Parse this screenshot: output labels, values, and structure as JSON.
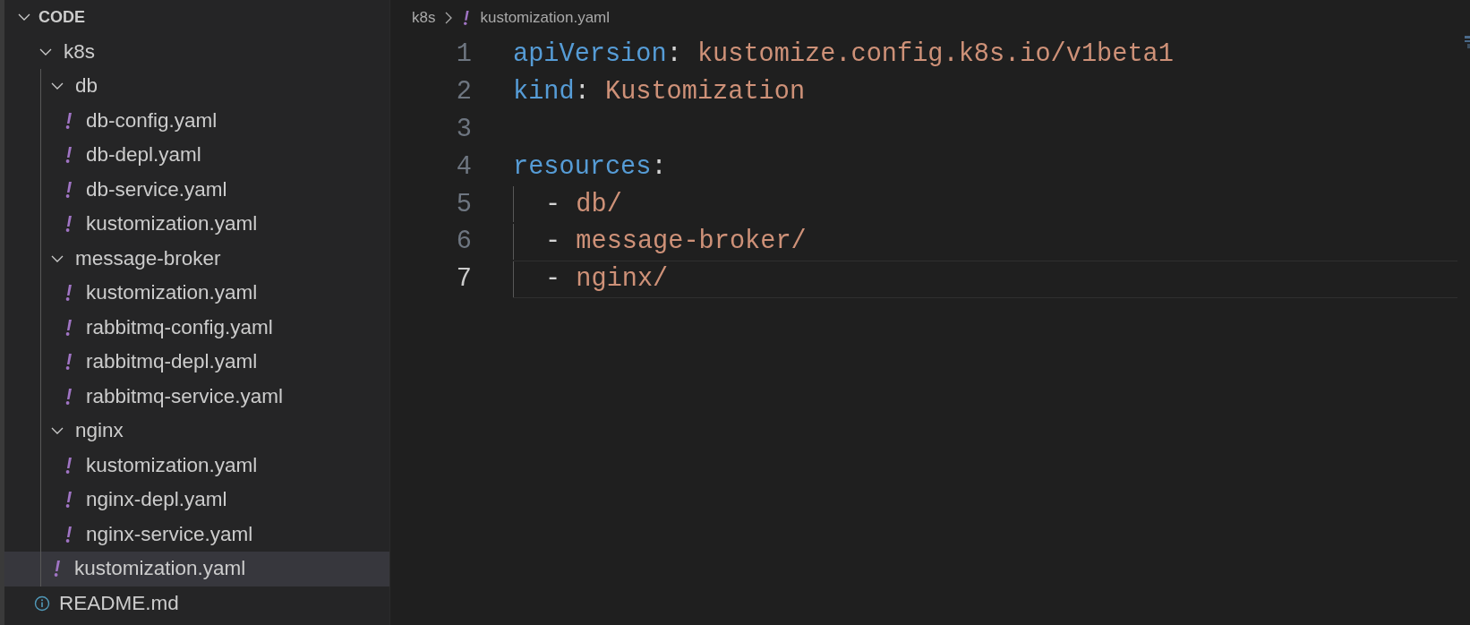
{
  "explorer": {
    "title": "CODE",
    "expanded": true,
    "items": [
      {
        "kind": "folder",
        "name": "k8s",
        "expanded": true,
        "selected": false,
        "children": [
          {
            "kind": "folder",
            "name": "db",
            "expanded": true,
            "selected": false,
            "children": [
              {
                "kind": "yaml",
                "name": "db-config.yaml",
                "selected": false
              },
              {
                "kind": "yaml",
                "name": "db-depl.yaml",
                "selected": false
              },
              {
                "kind": "yaml",
                "name": "db-service.yaml",
                "selected": false
              },
              {
                "kind": "yaml",
                "name": "kustomization.yaml",
                "selected": false
              }
            ]
          },
          {
            "kind": "folder",
            "name": "message-broker",
            "expanded": true,
            "selected": false,
            "children": [
              {
                "kind": "yaml",
                "name": "kustomization.yaml",
                "selected": false
              },
              {
                "kind": "yaml",
                "name": "rabbitmq-config.yaml",
                "selected": false
              },
              {
                "kind": "yaml",
                "name": "rabbitmq-depl.yaml",
                "selected": false
              },
              {
                "kind": "yaml",
                "name": "rabbitmq-service.yaml",
                "selected": false
              }
            ]
          },
          {
            "kind": "folder",
            "name": "nginx",
            "expanded": true,
            "selected": false,
            "children": [
              {
                "kind": "yaml",
                "name": "kustomization.yaml",
                "selected": false
              },
              {
                "kind": "yaml",
                "name": "nginx-depl.yaml",
                "selected": false
              },
              {
                "kind": "yaml",
                "name": "nginx-service.yaml",
                "selected": false
              }
            ]
          },
          {
            "kind": "yaml",
            "name": "kustomization.yaml",
            "selected": true
          }
        ]
      },
      {
        "kind": "info",
        "name": "README.md",
        "selected": false
      }
    ]
  },
  "editor": {
    "breadcrumb": [
      {
        "kind": "folder",
        "text": "k8s"
      },
      {
        "kind": "yaml",
        "text": "kustomization.yaml"
      }
    ],
    "lines": [
      {
        "number": "1",
        "active": false,
        "indented": false,
        "tokens": [
          {
            "kind": "key",
            "text": "apiVersion"
          },
          {
            "kind": "punct",
            "text": ": "
          },
          {
            "kind": "string",
            "text": "kustomize.config.k8s.io/v1beta1"
          }
        ]
      },
      {
        "number": "2",
        "active": false,
        "indented": false,
        "tokens": [
          {
            "kind": "key",
            "text": "kind"
          },
          {
            "kind": "punct",
            "text": ": "
          },
          {
            "kind": "string",
            "text": "Kustomization"
          }
        ]
      },
      {
        "number": "3",
        "active": false,
        "indented": false
      },
      {
        "number": "4",
        "active": false,
        "indented": false,
        "tokens": [
          {
            "kind": "key",
            "text": "resources"
          },
          {
            "kind": "punct",
            "text": ":"
          }
        ]
      },
      {
        "number": "5",
        "active": false,
        "indented": true,
        "tokens": [
          {
            "kind": "punct",
            "text": "- "
          },
          {
            "kind": "string",
            "text": "db/"
          }
        ]
      },
      {
        "number": "6",
        "active": false,
        "indented": true,
        "tokens": [
          {
            "kind": "punct",
            "text": "- "
          },
          {
            "kind": "string",
            "text": "message-broker/"
          }
        ]
      },
      {
        "number": "7",
        "active": true,
        "indented": true,
        "tokens": [
          {
            "kind": "punct",
            "text": "- "
          },
          {
            "kind": "string",
            "text": "nginx/"
          }
        ]
      }
    ]
  }
}
